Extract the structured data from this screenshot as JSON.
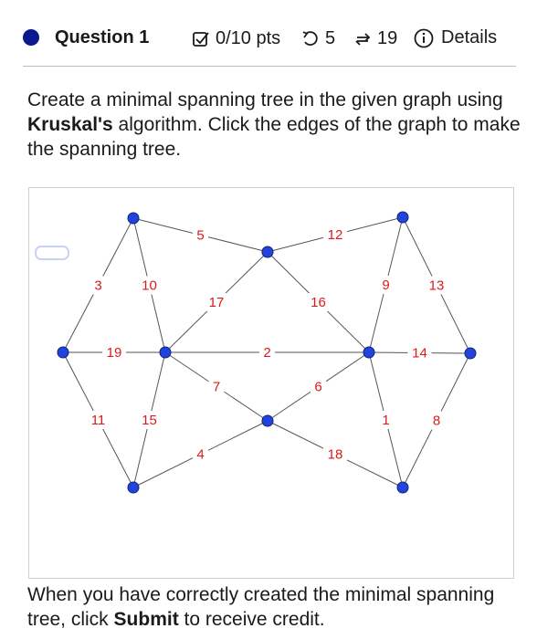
{
  "header": {
    "question_label": "Question 1",
    "points": "0/10 pts",
    "tries_left": "5",
    "attempts": "19",
    "details_label": "Details",
    "accent_color": "#0a1a8c"
  },
  "prompt": {
    "part1": "Create a minimal spanning tree in the given graph using ",
    "algorithm": "Kruskal's",
    "part2": " algorithm. Click the edges of the graph to make the spanning tree."
  },
  "footer": {
    "part1": "When you have correctly created the minimal spanning tree, click ",
    "submit_word": "Submit",
    "part2": " to receive credit."
  },
  "graph": {
    "vertex_color": "#2244dd",
    "label_color": "#dd1a1a",
    "vertices": [
      {
        "id": "A"
      },
      {
        "id": "B"
      },
      {
        "id": "C"
      },
      {
        "id": "D"
      },
      {
        "id": "E"
      },
      {
        "id": "F"
      },
      {
        "id": "G"
      },
      {
        "id": "H"
      },
      {
        "id": "I"
      },
      {
        "id": "J"
      }
    ],
    "edges": [
      {
        "from": "A",
        "to": "B",
        "weight": "5"
      },
      {
        "from": "B",
        "to": "C",
        "weight": "12"
      },
      {
        "from": "A",
        "to": "D",
        "weight": "3"
      },
      {
        "from": "A",
        "to": "E",
        "weight": "10"
      },
      {
        "from": "B",
        "to": "E",
        "weight": "17"
      },
      {
        "from": "B",
        "to": "F",
        "weight": "16"
      },
      {
        "from": "C",
        "to": "F",
        "weight": "9"
      },
      {
        "from": "C",
        "to": "G",
        "weight": "13"
      },
      {
        "from": "D",
        "to": "E",
        "weight": "19"
      },
      {
        "from": "E",
        "to": "F",
        "weight": "2"
      },
      {
        "from": "F",
        "to": "G",
        "weight": "14"
      },
      {
        "from": "E",
        "to": "H",
        "weight": "7"
      },
      {
        "from": "F",
        "to": "H",
        "weight": "6"
      },
      {
        "from": "D",
        "to": "I",
        "weight": "11"
      },
      {
        "from": "E",
        "to": "I",
        "weight": "15"
      },
      {
        "from": "H",
        "to": "I",
        "weight": "4"
      },
      {
        "from": "H",
        "to": "J",
        "weight": "18"
      },
      {
        "from": "F",
        "to": "J",
        "weight": "1"
      },
      {
        "from": "G",
        "to": "J",
        "weight": "8"
      }
    ]
  }
}
